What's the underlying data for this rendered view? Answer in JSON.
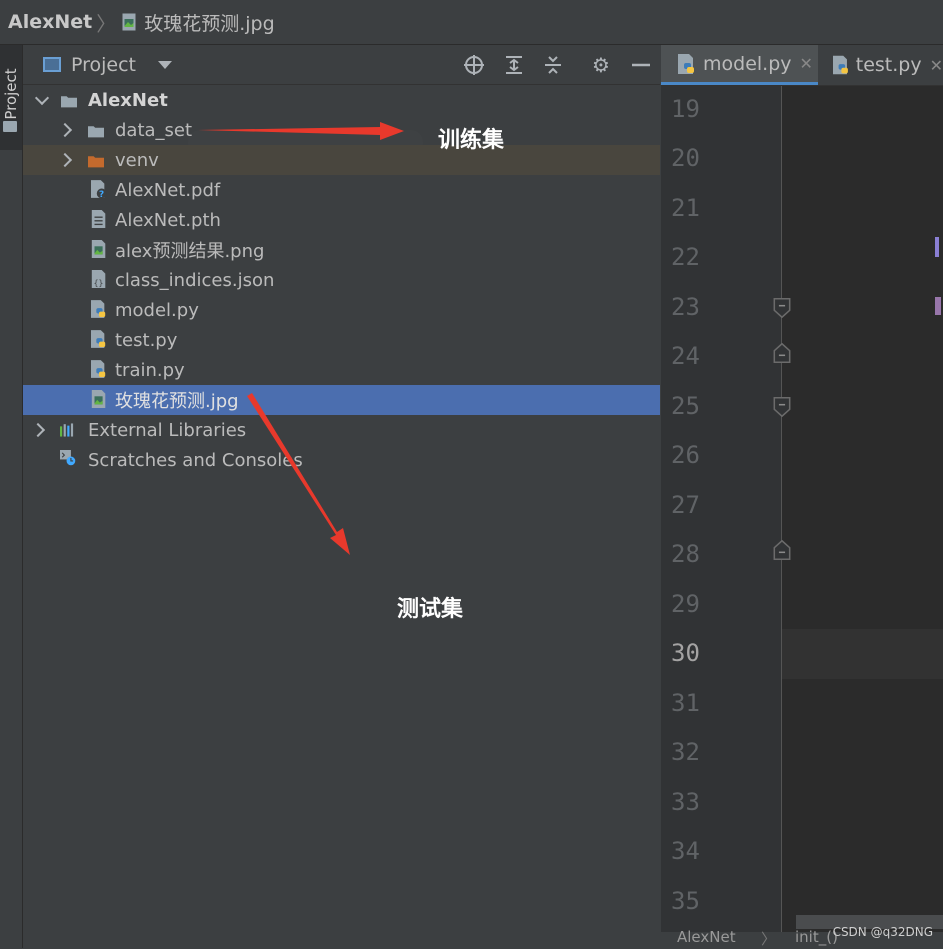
{
  "breadcrumb": {
    "project": "AlexNet",
    "file": "玫瑰花预测.jpg"
  },
  "tool_window": {
    "vertical_tab_label": "Project"
  },
  "panel": {
    "title": "Project",
    "toolbar_icons": [
      "locate-icon",
      "expand-all-icon",
      "collapse-all-icon",
      "gear-icon",
      "minimize-icon"
    ]
  },
  "tree": {
    "root": "AlexNet",
    "items": [
      {
        "label": "data_set",
        "icon": "folder-icon",
        "expandable": true
      },
      {
        "label": "venv",
        "icon": "excluded-folder-icon",
        "expandable": true
      },
      {
        "label": "AlexNet.pdf",
        "icon": "unknown-file-icon"
      },
      {
        "label": "AlexNet.pth",
        "icon": "text-file-icon"
      },
      {
        "label": "alex预测结果.png",
        "icon": "image-file-icon"
      },
      {
        "label": "class_indices.json",
        "icon": "json-file-icon"
      },
      {
        "label": "model.py",
        "icon": "python-file-icon"
      },
      {
        "label": "test.py",
        "icon": "python-file-icon"
      },
      {
        "label": "train.py",
        "icon": "python-file-icon"
      },
      {
        "label": "玫瑰花预测.jpg",
        "icon": "image-file-icon",
        "selected": true
      }
    ],
    "external_libraries": "External Libraries",
    "scratches": "Scratches and Consoles"
  },
  "annotations": {
    "train_set": "训练集",
    "test_set": "测试集"
  },
  "editor": {
    "tabs": [
      {
        "label": "model.py",
        "active": true
      },
      {
        "label": "test.py",
        "active": false
      }
    ],
    "line_numbers": [
      "19",
      "20",
      "21",
      "22",
      "23",
      "24",
      "25",
      "26",
      "27",
      "28",
      "29",
      "30",
      "31",
      "32",
      "33",
      "34",
      "35"
    ],
    "current_line": "30",
    "status_crumbs": [
      "AlexNet",
      "init_()"
    ]
  },
  "watermark": "CSDN @q32DNG",
  "colors": {
    "selection": "#4b6eaf",
    "annotation_arrow": "#e8392c",
    "excluded_folder": "#c46a2d"
  }
}
